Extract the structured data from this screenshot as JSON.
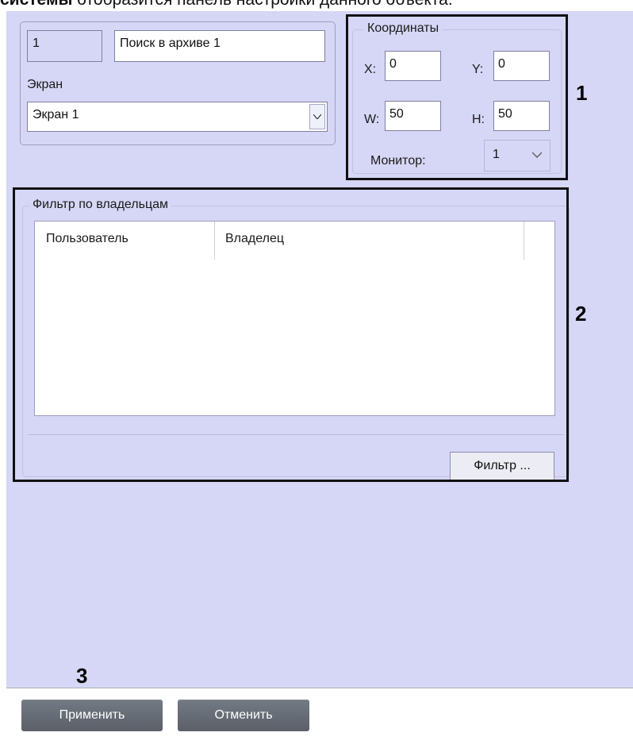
{
  "caption": {
    "bold_part": "системы",
    "rest": " отобразится панель настройки данного объекта."
  },
  "object": {
    "id_value": "1",
    "name_value": "Поиск в архиве 1",
    "screen_label": "Экран",
    "screen_value": "Экран 1"
  },
  "coordinates": {
    "legend": "Координаты",
    "x_label": "X:",
    "x_value": "0",
    "y_label": "Y:",
    "y_value": "0",
    "w_label": "W:",
    "w_value": "50",
    "h_label": "H:",
    "h_value": "50",
    "monitor_label": "Монитор:",
    "monitor_value": "1"
  },
  "owner_filter": {
    "legend": "Фильтр по владельцам",
    "columns": [
      "Пользователь",
      "Владелец"
    ],
    "filter_button": "Фильтр ..."
  },
  "footer": {
    "apply_label": "Применить",
    "cancel_label": "Отменить"
  },
  "markers": [
    "1",
    "2",
    "3"
  ],
  "colors": {
    "panel_bg": "#d6d6f6",
    "footer_button": "#5f646d",
    "callout_border": "#111111"
  }
}
